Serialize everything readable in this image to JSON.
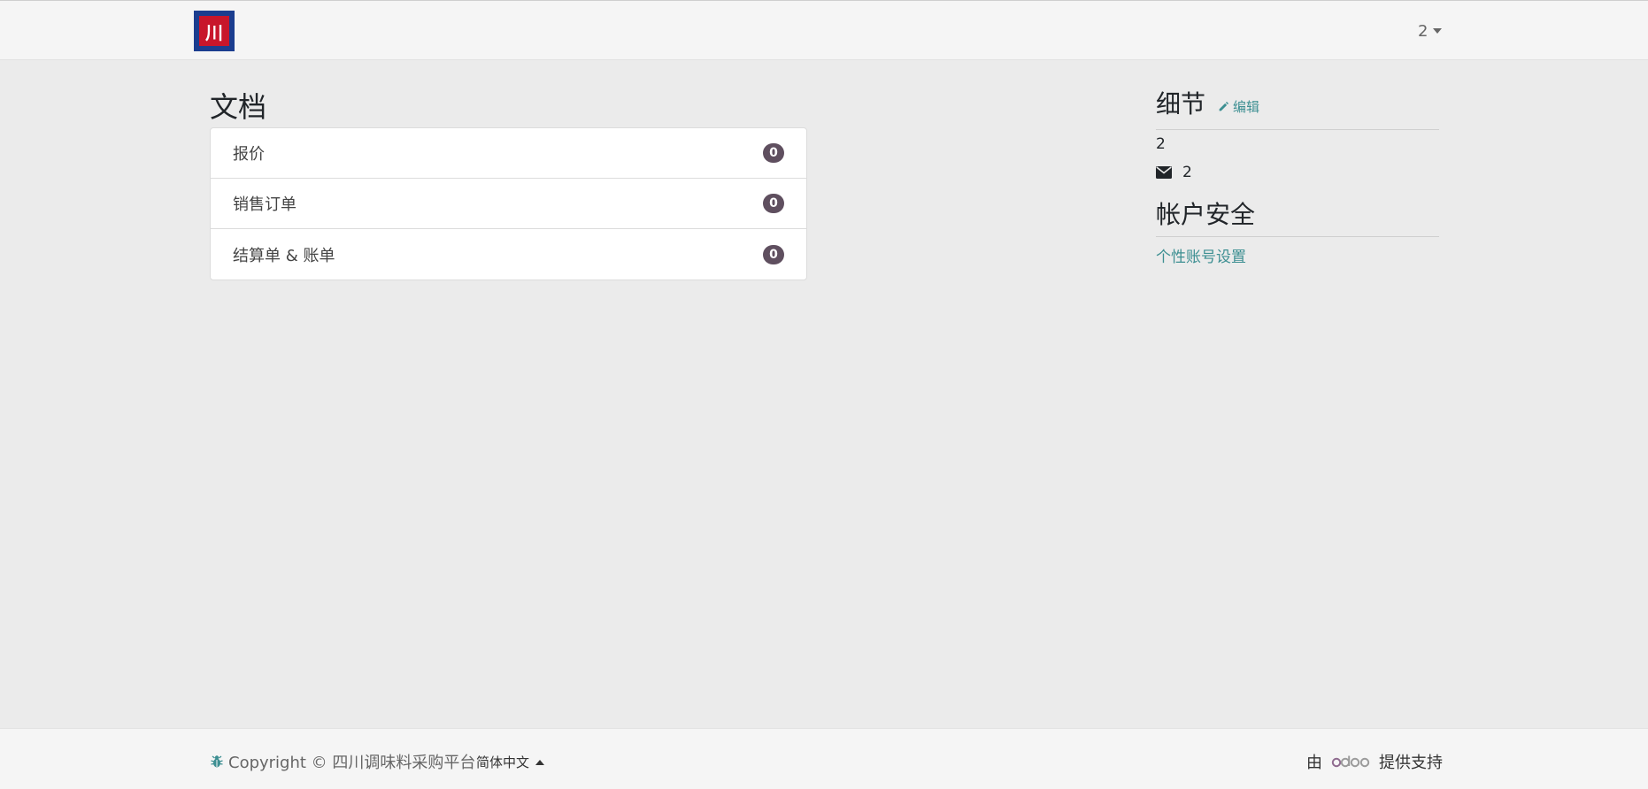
{
  "header": {
    "logo_text": "川",
    "user_label": "2"
  },
  "documents": {
    "title": "文档",
    "items": [
      {
        "label": "报价",
        "count": "0"
      },
      {
        "label": "销售订单",
        "count": "0"
      },
      {
        "label": "结算单 & 账单",
        "count": "0"
      }
    ]
  },
  "details": {
    "title": "细节",
    "edit_label": "编辑",
    "name": "2",
    "email": "2"
  },
  "security": {
    "title": "帐户安全",
    "settings_link": "个性账号设置"
  },
  "footer": {
    "copyright": "Copyright © 四川调味料采购平台",
    "language": "简体中文",
    "powered_prefix": "由",
    "powered_suffix": "提供支持"
  },
  "colors": {
    "accent": "#3d8f92",
    "badge": "#5f4f5f",
    "page_bg": "#ebebeb",
    "bar_bg": "#f5f5f5"
  }
}
